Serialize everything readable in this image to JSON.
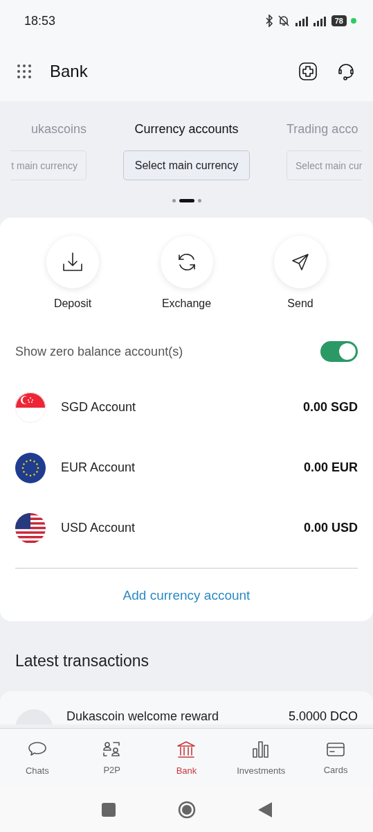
{
  "status_bar": {
    "time": "18:53",
    "battery": "78"
  },
  "header": {
    "title": "Bank"
  },
  "carousel": {
    "slides": [
      {
        "title": "ukascoins",
        "button": "t main currency",
        "selected": false
      },
      {
        "title": "Currency accounts",
        "button": "Select main currency",
        "selected": true
      },
      {
        "title": "Trading acco",
        "button": "Select main cur",
        "selected": false
      }
    ],
    "dots": [
      {
        "selected": false
      },
      {
        "selected": true
      },
      {
        "selected": false
      }
    ]
  },
  "actions": [
    {
      "label": "Deposit",
      "kind": "deposit"
    },
    {
      "label": "Exchange",
      "kind": "exchange"
    },
    {
      "label": "Send",
      "kind": "send"
    }
  ],
  "zero_balance": {
    "label": "Show zero balance account(s)",
    "on": true
  },
  "accounts": [
    {
      "name": "SGD Account",
      "balance": "0.00 SGD",
      "kind": "sgd"
    },
    {
      "name": "EUR Account",
      "balance": "0.00 EUR",
      "kind": "eur"
    },
    {
      "name": "USD Account",
      "balance": "0.00 USD",
      "kind": "usd"
    }
  ],
  "add_account": "Add currency account",
  "latest": {
    "title": "Latest transactions",
    "rows": [
      {
        "name": "Dukascoin welcome reward",
        "amount": "5.0000 DCO"
      }
    ]
  },
  "nav": [
    {
      "label": "Chats",
      "kind": "chats",
      "selected": false
    },
    {
      "label": "P2P",
      "kind": "p2p",
      "selected": false
    },
    {
      "label": "Bank",
      "kind": "bank",
      "selected": true
    },
    {
      "label": "Investments",
      "kind": "investments",
      "selected": false
    },
    {
      "label": "Cards",
      "kind": "cards",
      "selected": false
    }
  ]
}
